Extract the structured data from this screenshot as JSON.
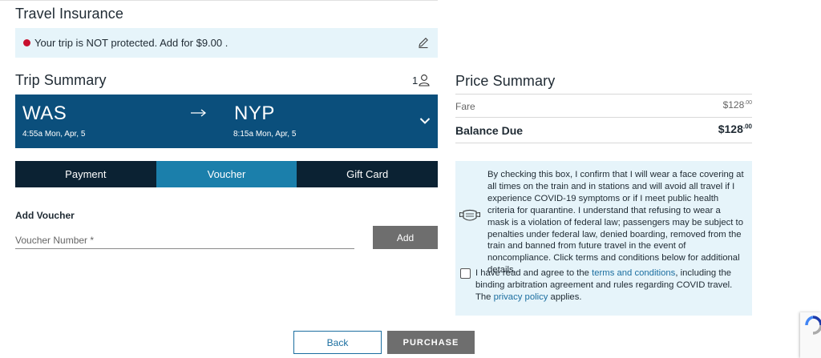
{
  "travel_insurance": {
    "title": "Travel Insurance",
    "message": "Your trip is NOT protected. Add for $9.00 ."
  },
  "trip_summary": {
    "title": "Trip Summary",
    "passenger_count": "1",
    "origin": {
      "code": "WAS",
      "time": "4:55a",
      "date": "Mon, Apr, 5"
    },
    "destination": {
      "code": "NYP",
      "time": "8:15a",
      "date": "Mon, Apr, 5"
    }
  },
  "payment_tabs": [
    {
      "label": "Payment",
      "active": false
    },
    {
      "label": "Voucher",
      "active": true
    },
    {
      "label": "Gift Card",
      "active": false
    }
  ],
  "voucher": {
    "heading": "Add Voucher",
    "placeholder": "Voucher Number *",
    "add_label": "Add"
  },
  "price_summary": {
    "title": "Price Summary",
    "fare_label": "Fare",
    "fare_dollars": "$128",
    "fare_cents": ".00",
    "balance_label": "Balance Due",
    "balance_dollars": "$128",
    "balance_cents": ".00"
  },
  "covid": {
    "statement": "By checking this box, I confirm that I will wear a face covering at all times on the train and in stations and will avoid all travel if I experience COVID-19 symptoms or if I meet public health criteria for quarantine. I understand that refusing to wear a mask is a violation of federal law; passengers may be subject to penalties under federal law, denied boarding, removed from the train and banned from future travel in the event of noncompliance. Click terms and conditions below for additional details.",
    "agree_prefix": "I have read and agree to the ",
    "terms_link": "terms and conditions",
    "agree_middle": ", including the binding arbitration agreement and rules regarding COVID travel. The ",
    "privacy_link": "privacy policy",
    "agree_suffix": " applies."
  },
  "actions": {
    "back_label": "Back",
    "purchase_label": "PURCHASE"
  },
  "colors": {
    "trip_card": "#0b4f7c",
    "tab_bar": "#0b2233",
    "tab_active": "#1b7fab",
    "info_bg": "#e6f4fa",
    "alert_red": "#c8102e",
    "disabled_button": "#6e6e6e",
    "link": "#1b6ea0"
  },
  "icons": [
    "pencil-icon",
    "user-icon",
    "arrow-right-icon",
    "chevron-down-icon",
    "face-mask-icon",
    "recaptcha-icon"
  ]
}
